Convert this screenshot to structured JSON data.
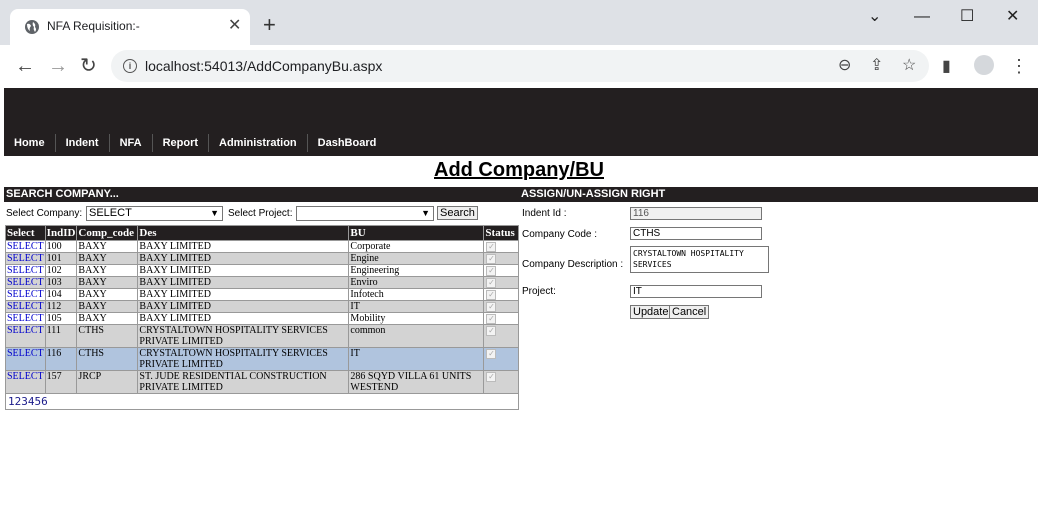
{
  "browser": {
    "tab_title": "NFA Requisition:-",
    "url": "localhost:54013/AddCompanyBu.aspx"
  },
  "menu": [
    "Home",
    "Indent",
    "NFA",
    "Report",
    "Administration",
    "DashBoard"
  ],
  "page_title": "Add Company/BU",
  "search": {
    "header": "SEARCH COMPANY...",
    "company_label": "Select Company:",
    "company_value": "SELECT",
    "project_label": "Select Project:",
    "project_value": "",
    "search_button": "Search"
  },
  "grid": {
    "headers": [
      "Select",
      "IndID",
      "Comp_code",
      "Des",
      "BU",
      "Status"
    ],
    "rows": [
      {
        "link": "SELECT",
        "id": "100",
        "code": "BAXY",
        "des": "BAXY LIMITED",
        "bu": "Corporate"
      },
      {
        "link": "SELECT",
        "id": "101",
        "code": "BAXY",
        "des": "BAXY LIMITED",
        "bu": "Engine"
      },
      {
        "link": "SELECT",
        "id": "102",
        "code": "BAXY",
        "des": "BAXY LIMITED",
        "bu": "Engineering"
      },
      {
        "link": "SELECT",
        "id": "103",
        "code": "BAXY",
        "des": "BAXY LIMITED",
        "bu": "Enviro"
      },
      {
        "link": "SELECT",
        "id": "104",
        "code": "BAXY",
        "des": "BAXY LIMITED",
        "bu": "Infotech"
      },
      {
        "link": "SELECT",
        "id": "112",
        "code": "BAXY",
        "des": "BAXY LIMITED",
        "bu": "IT"
      },
      {
        "link": "SELECT",
        "id": "105",
        "code": "BAXY",
        "des": "BAXY LIMITED",
        "bu": "Mobility"
      },
      {
        "link": "SELECT",
        "id": "111",
        "code": "CTHS",
        "des": "CRYSTALTOWN HOSPITALITY SERVICES PRIVATE LIMITED",
        "bu": "common"
      },
      {
        "link": "SELECT",
        "id": "116",
        "code": "CTHS",
        "des": "CRYSTALTOWN HOSPITALITY SERVICES PRIVATE LIMITED",
        "bu": "IT"
      },
      {
        "link": "SELECT",
        "id": "157",
        "code": "JRCP",
        "des": "ST. JUDE RESIDENTIAL CONSTRUCTION PRIVATE LIMITED",
        "bu": "286 SQYD VILLA 61 UNITS WESTEND"
      }
    ],
    "pager": "123456"
  },
  "assign": {
    "header": "ASSIGN/UN-ASSIGN RIGHT",
    "indent_label": "Indent Id :",
    "indent_value": "116",
    "code_label": "Company Code :",
    "code_value": "CTHS",
    "desc_label": "Company Description :",
    "desc_value": "CRYSTALTOWN HOSPITALITY SERVICES",
    "project_label": "Project:",
    "project_value": "IT",
    "update_button": "Update",
    "cancel_button": "Cancel"
  }
}
